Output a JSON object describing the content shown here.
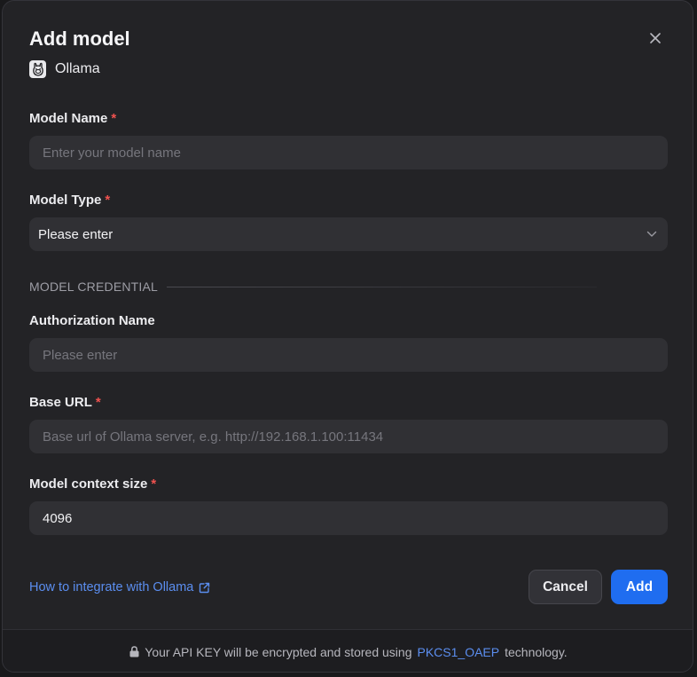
{
  "dialog": {
    "title": "Add model",
    "provider": "Ollama",
    "required_mark": "*"
  },
  "fields": {
    "model_name": {
      "label": "Model Name",
      "placeholder": "Enter your model name",
      "value": ""
    },
    "model_type": {
      "label": "Model Type",
      "value": "Please enter"
    },
    "section_title": "MODEL CREDENTIAL",
    "authorization_name": {
      "label": "Authorization Name",
      "placeholder": "Please enter",
      "value": ""
    },
    "base_url": {
      "label": "Base URL",
      "placeholder": "Base url of Ollama server, e.g. http://192.168.1.100:11434",
      "value": ""
    },
    "context_size": {
      "label": "Model context size",
      "value": "4096"
    }
  },
  "actions": {
    "help_link": "How to integrate with Ollama",
    "cancel": "Cancel",
    "add": "Add"
  },
  "footer": {
    "text_before": "Your API KEY will be encrypted and stored using",
    "link": "PKCS1_OAEP",
    "text_after": "technology."
  },
  "colors": {
    "accent": "#1f6df0",
    "link": "#5b8ef0",
    "required": "#f0524f",
    "dialog_bg": "#232326"
  },
  "icons": [
    "close-icon",
    "ollama-logo-icon",
    "chevron-down-icon",
    "external-link-icon",
    "lock-icon"
  ]
}
